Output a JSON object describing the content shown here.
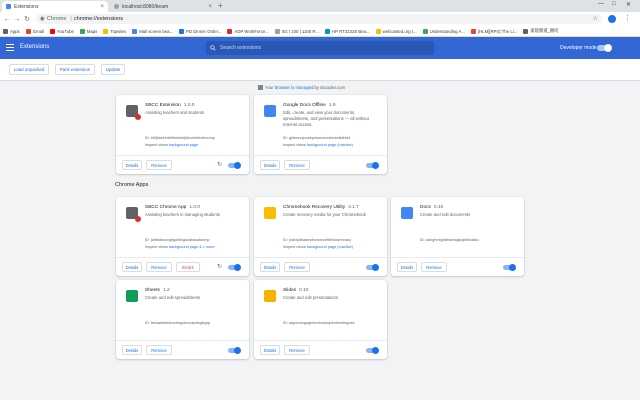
{
  "browser": {
    "tabs": [
      {
        "label": "Extensions",
        "active": true
      },
      {
        "label": "localhost:8080/beam",
        "active": false
      }
    ],
    "new_tab_glyph": "+",
    "site_chip": "Chrome",
    "url": "chrome://extensions",
    "bookmarks": [
      {
        "label": "Apps",
        "color": "#5f6368"
      },
      {
        "label": "Gmail",
        "color": "#ea4335"
      },
      {
        "label": "YouTube",
        "color": "#ff0000"
      },
      {
        "label": "Maps",
        "color": "#34a853"
      },
      {
        "label": "Topsites",
        "color": "#fbbc04"
      },
      {
        "label": "Mail screen bea...",
        "color": "#4285f4"
      },
      {
        "label": "PD Dinner Order...",
        "color": "#1a73e8"
      },
      {
        "label": "ADP WorkForce...",
        "color": "#d93025"
      },
      {
        "label": "5G I 100 | 1100 R...",
        "color": "#9aa0a6"
      },
      {
        "label": "HP RT3133S Bea...",
        "color": "#0096d6"
      },
      {
        "label": "webcasted.org t...",
        "color": "#fbbc04"
      },
      {
        "label": "Understanding A...",
        "color": "#34a853"
      },
      {
        "label": "[HLM][RPS] The Li...",
        "color": "#ea4335"
      },
      {
        "label": "发现频道_顾问",
        "color": "#5f6368"
      }
    ]
  },
  "header": {
    "title": "Extensions",
    "search_placeholder": "Search extensions",
    "developer_mode_label": "Developer mode",
    "developer_mode_on": true
  },
  "actions": {
    "load_unpacked": "Load unpacked",
    "pack_extension": "Pack extension",
    "update": "Update"
  },
  "managed": {
    "prefix": "Your",
    "link": "browser is managed",
    "suffix": "by sbcodev.com"
  },
  "chrome_apps_title": "Chrome Apps",
  "cards": [
    {
      "name": "SBCC Extension",
      "version": "1.0.0",
      "description": "Assisting teachers and students",
      "id": "ID: ef0jbbbhhfdhfmklohjbbcmhblhdhcomp",
      "inspect_prefix": "Inspect views",
      "inspect_link": "background page",
      "details": "Details",
      "remove": "Remove",
      "errors": "",
      "icon_color": "#5f6368",
      "has_badge": true,
      "reload": true,
      "enabled": true
    },
    {
      "name": "Google Docs Offline",
      "version": "1.9",
      "description": "Edit, create, and view your documents, spreadsheets, and presentations — all without Internet access.",
      "id": "ID: ghbmnnjooekpmoecnnnilnnbdlolhkhi",
      "inspect_prefix": "Inspect views",
      "inspect_link": "background page (Inactive)",
      "details": "Details",
      "remove": "Remove",
      "errors": "",
      "icon_color": "#4285f4",
      "has_badge": false,
      "reload": false,
      "enabled": true
    },
    {
      "name": "SBCC Chrome App",
      "version": "1.0.0",
      "description": "Assisting teachers in managing students",
      "id": "ID: jahfkabocngfigdhlhgdodbacaldomp",
      "inspect_prefix": "Inspect views",
      "inspect_link": "background page & 1 more",
      "details": "Details",
      "remove": "Remove",
      "errors": "Errors",
      "icon_color": "#5f6368",
      "has_badge": true,
      "reload": true,
      "enabled": true
    },
    {
      "name": "Chromebook Recovery Utility",
      "version": "3.1.7",
      "description": "Create recovery media for your Chromebook",
      "id": "ID: jndclpdbaamdhonoechfbfnlcamhnacj",
      "inspect_prefix": "Inspect views",
      "inspect_link": "background page (Inactive)",
      "details": "Details",
      "remove": "Remove",
      "errors": "",
      "icon_color": "#fbbc04",
      "has_badge": false,
      "reload": false,
      "enabled": true
    },
    {
      "name": "Docs",
      "version": "0.10",
      "description": "Create and edit documents",
      "id": "ID: aohghmighlieiamagkcijhbkdako",
      "inspect_prefix": "",
      "inspect_link": "",
      "details": "Details",
      "remove": "Remove",
      "errors": "",
      "icon_color": "#4285f4",
      "has_badge": false,
      "reload": false,
      "enabled": true
    },
    {
      "name": "Sheets",
      "version": "1.2",
      "description": "Create and edit spreadsheets",
      "id": "ID: felcaaldnbdncclmgdcncolpebgiejap",
      "inspect_prefix": "",
      "inspect_link": "",
      "details": "Details",
      "remove": "Remove",
      "errors": "",
      "icon_color": "#0f9d58",
      "has_badge": false,
      "reload": false,
      "enabled": true
    },
    {
      "name": "Slides",
      "version": "0.10",
      "description": "Create and edit presentations",
      "id": "ID: aapocclcgogkmnckokdopfmhonfmgoek",
      "inspect_prefix": "",
      "inspect_link": "",
      "details": "Details",
      "remove": "Remove",
      "errors": "",
      "icon_color": "#f4b400",
      "has_badge": false,
      "reload": false,
      "enabled": true
    }
  ]
}
